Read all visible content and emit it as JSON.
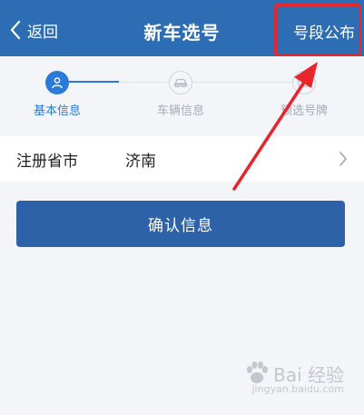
{
  "header": {
    "back_label": "返回",
    "title": "新车选号",
    "announce_label": "号段公布"
  },
  "steps": [
    {
      "label": "基本信息",
      "icon": "user-icon",
      "state": "active"
    },
    {
      "label": "车辆信息",
      "icon": "car-icon",
      "state": "inactive"
    },
    {
      "label": "预选号牌",
      "icon": "plate-icon",
      "state": "inactive"
    }
  ],
  "form": {
    "province_city_label": "注册省市",
    "province_city_value": "济南"
  },
  "confirm_label": "确认信息",
  "watermark": {
    "brand": "Bai 经验",
    "site": "jingyan.baidu.com"
  },
  "colors": {
    "header": "#2d6db3",
    "accent": "#2a7ad9",
    "button": "#2d62a8",
    "annotation": "#e8252b"
  }
}
